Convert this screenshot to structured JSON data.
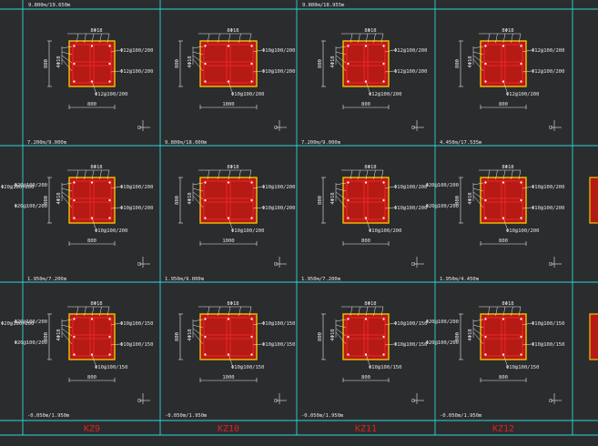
{
  "colors": {
    "background": "#2b2c2e",
    "grid_line": "#2fd6d6",
    "column_fill": "#b51a15",
    "column_outline": "#f2c400",
    "rebar_red": "#ff2a2a",
    "annotation": "#e8e8e8",
    "grade_label": "#e02020"
  },
  "column_labels": [
    "KZ9",
    "KZ10",
    "KZ11",
    "KZ12"
  ],
  "rows": [
    {
      "cells": [
        {
          "elevation": "9.800m/19.650m",
          "top_rebar": "8Φ18",
          "side_rebar": "4Φ18",
          "stirrup_right_1": "Φ12@100/200",
          "stirrup_right_2": "Φ12@100/200",
          "stirrup_bottom": "Φ12@100/200",
          "height_dim": "800",
          "width_dim": "800",
          "wide": false
        },
        {
          "elevation": "",
          "top_rebar": "8Φ18",
          "side_rebar": "4Φ18",
          "stirrup_right_1": "Φ10@100/200",
          "stirrup_right_2": "Φ10@100/200",
          "stirrup_bottom": "Φ10@100/200",
          "height_dim": "800",
          "width_dim": "1000",
          "wide": true
        },
        {
          "elevation": "9.800m/18.955m",
          "top_rebar": "8Φ18",
          "side_rebar": "4Φ18",
          "stirrup_right_1": "Φ12@100/200",
          "stirrup_right_2": "Φ12@100/200",
          "stirrup_bottom": "Φ12@100/200",
          "height_dim": "800",
          "width_dim": "800",
          "wide": false
        },
        {
          "elevation": "",
          "top_rebar": "8Φ18",
          "side_rebar": "4Φ18",
          "stirrup_right_1": "Φ12@100/200",
          "stirrup_right_2": "Φ12@100/200",
          "stirrup_bottom": "Φ12@100/200",
          "height_dim": "800",
          "width_dim": "800",
          "wide": false
        }
      ],
      "bottom_elevations": [
        "7.200m/9.000m",
        "9.800m/18.000m",
        "7.200m/9.000m",
        "4.450m/17.535m"
      ]
    },
    {
      "cells": [
        {
          "left_1": "Φ20@100/200",
          "left_2": "Φ20@100/200",
          "top_rebar": "8Φ18",
          "side_rebar": "4Φ18",
          "stirrup_right_1": "Φ10@100/200",
          "stirrup_right_2": "Φ10@100/200",
          "stirrup_bottom": "Φ10@100/200",
          "height_dim": "800",
          "width_dim": "800",
          "wide": false
        },
        {
          "left_1": "",
          "left_2": "",
          "top_rebar": "8Φ18",
          "side_rebar": "4Φ18",
          "stirrup_right_1": "Φ10@100/200",
          "stirrup_right_2": "Φ10@100/200",
          "stirrup_bottom": "Φ10@100/200",
          "height_dim": "800",
          "width_dim": "1000",
          "wide": true
        },
        {
          "left_1": "",
          "left_2": "",
          "top_rebar": "8Φ18",
          "side_rebar": "4Φ18",
          "stirrup_right_1": "Φ10@100/200",
          "stirrup_right_2": "Φ10@100/200",
          "stirrup_bottom": "Φ10@100/200",
          "height_dim": "800",
          "width_dim": "800",
          "wide": false
        },
        {
          "left_1": "Φ20@100/200",
          "left_2": "Φ20@100/200",
          "top_rebar": "8Φ18",
          "side_rebar": "4Φ18",
          "stirrup_right_1": "Φ10@100/200",
          "stirrup_right_2": "Φ10@100/200",
          "stirrup_bottom": "Φ10@100/200",
          "height_dim": "800",
          "width_dim": "800",
          "wide": false
        }
      ],
      "bottom_elevations": [
        "1.950m/7.200m",
        "1.950m/9.000m",
        "1.950m/7.200m",
        "1.950m/4.450m"
      ]
    },
    {
      "cells": [
        {
          "left_1": "Φ20@100/200",
          "left_2": "Φ20@100/200",
          "top_rebar": "8Φ18",
          "side_rebar": "4Φ18",
          "stirrup_right_1": "Φ10@100/150",
          "stirrup_right_2": "Φ10@100/150",
          "stirrup_bottom": "Φ10@100/150",
          "height_dim": "800",
          "width_dim": "800",
          "wide": false
        },
        {
          "left_1": "",
          "left_2": "",
          "top_rebar": "8Φ18",
          "side_rebar": "4Φ18",
          "stirrup_right_1": "Φ10@100/150",
          "stirrup_right_2": "Φ10@100/150",
          "stirrup_bottom": "Φ10@100/150",
          "height_dim": "800",
          "width_dim": "1000",
          "wide": true
        },
        {
          "left_1": "",
          "left_2": "",
          "top_rebar": "8Φ18",
          "side_rebar": "4Φ18",
          "stirrup_right_1": "Φ10@100/150",
          "stirrup_right_2": "Φ10@100/150",
          "stirrup_bottom": "Φ10@100/150",
          "height_dim": "800",
          "width_dim": "800",
          "wide": false
        },
        {
          "left_1": "Φ20@100/200",
          "left_2": "Φ20@100/200",
          "top_rebar": "8Φ18",
          "side_rebar": "4Φ18",
          "stirrup_right_1": "Φ10@100/150",
          "stirrup_right_2": "Φ10@100/150",
          "stirrup_bottom": "Φ10@100/150",
          "height_dim": "800",
          "width_dim": "800",
          "wide": false
        }
      ],
      "bottom_elevations": [
        "-0.050m/1.950m",
        "-0.050m/1.950m",
        "-0.050m/1.950m",
        "-0.050m/1.950m"
      ]
    }
  ]
}
